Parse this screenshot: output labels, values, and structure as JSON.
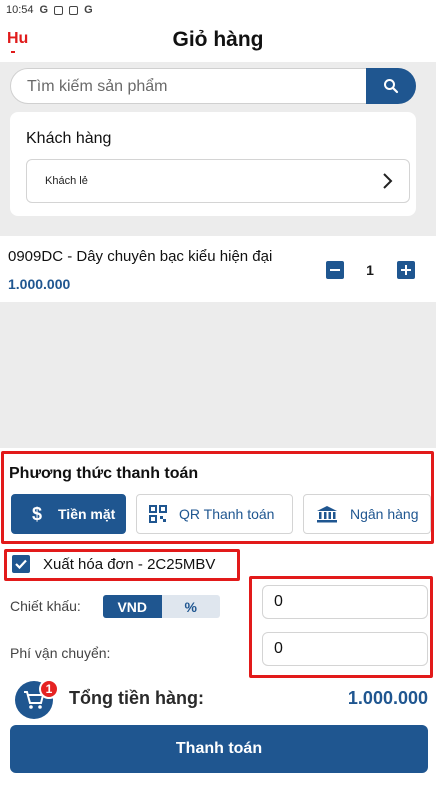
{
  "status_bar": {
    "time": "10:54",
    "icons": [
      "google-icon",
      "photo-icon",
      "square-icon",
      "google-icon"
    ]
  },
  "header": {
    "back_label": "Hu",
    "title": "Giỏ hàng"
  },
  "search": {
    "placeholder": "Tìm kiếm sản phẩm",
    "icon": "search-icon"
  },
  "customer": {
    "label": "Khách hàng",
    "value": "Khách lẻ",
    "icon": "chevron-right-icon"
  },
  "cart_items": [
    {
      "name": "0909DC - Dây chuyên bạc kiểu hiện đại",
      "price": "1.000.000",
      "quantity": "1"
    }
  ],
  "payment": {
    "title": "Phương thức thanh toán",
    "methods": [
      {
        "label": "Tiền mặt",
        "icon": "dollar-icon",
        "active": true
      },
      {
        "label": "QR Thanh toán",
        "icon": "qr-code-icon",
        "active": false
      },
      {
        "label": "Ngân hàng",
        "icon": "bank-icon",
        "active": false
      }
    ]
  },
  "invoice": {
    "label": "Xuất hóa đơn - 2C25MBV",
    "checked": true
  },
  "discount": {
    "label": "Chiết khấu:",
    "options": [
      "VND",
      "%"
    ],
    "selected": "VND",
    "value": "0"
  },
  "shipping": {
    "label": "Phí vận chuyển:",
    "value": "0"
  },
  "summary": {
    "cart_badge": "1",
    "total_label": "Tổng tiền hàng:",
    "total_value": "1.000.000"
  },
  "checkout": {
    "label": "Thanh toán"
  },
  "colors": {
    "primary": "#1f5690",
    "highlight": "#e21a1a",
    "back": "#e01b1b"
  }
}
